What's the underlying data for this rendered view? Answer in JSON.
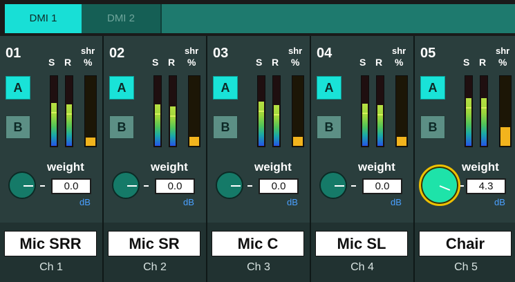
{
  "tabs": [
    {
      "label": "DMI 1",
      "active": true
    },
    {
      "label": "DMI 2",
      "active": false
    }
  ],
  "labels": {
    "s": "S",
    "r": "R",
    "shr_top": "shr",
    "shr_bottom": "%",
    "weight": "weight",
    "unit": "dB"
  },
  "channels": [
    {
      "num": "01",
      "a": "A",
      "b": "B",
      "weight": "0.0",
      "name": "Mic SRR",
      "ch": "Ch 1",
      "meter_s": 0.62,
      "meter_r": 0.6,
      "shr_pct": 0.12
    },
    {
      "num": "02",
      "a": "A",
      "b": "B",
      "weight": "0.0",
      "name": "Mic SR",
      "ch": "Ch 2",
      "meter_s": 0.6,
      "meter_r": 0.57,
      "shr_pct": 0.13
    },
    {
      "num": "03",
      "a": "A",
      "b": "B",
      "weight": "0.0",
      "name": "Mic C",
      "ch": "Ch 3",
      "meter_s": 0.64,
      "meter_r": 0.59,
      "shr_pct": 0.13
    },
    {
      "num": "04",
      "a": "A",
      "b": "B",
      "weight": "0.0",
      "name": "Mic SL",
      "ch": "Ch 4",
      "meter_s": 0.61,
      "meter_r": 0.59,
      "shr_pct": 0.13
    },
    {
      "num": "05",
      "a": "A",
      "b": "B",
      "weight": "4.3",
      "name": "Chair",
      "ch": "Ch 5",
      "meter_s": 0.69,
      "meter_r": 0.69,
      "shr_pct": 0.27
    }
  ],
  "colors": {
    "accent": "#18dfd6",
    "meter_peak": "#d7f05a",
    "shr_fill": "#f2b41d",
    "knob_ring_active": "#f0c000",
    "db_text": "#4aa0ff"
  }
}
